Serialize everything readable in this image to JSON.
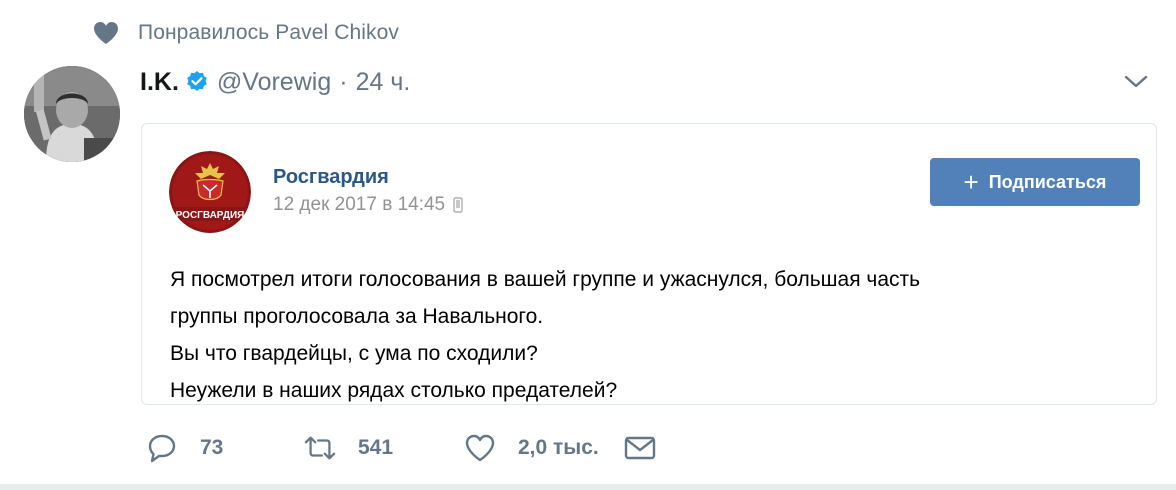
{
  "social_context": {
    "text": "Понравилось Pavel Chikov",
    "icon": "heart-icon"
  },
  "tweet": {
    "author_name": "I.K.",
    "handle": "@Vorewig",
    "separator": "·",
    "time": "24 ч.",
    "verified": true
  },
  "vk_post": {
    "group_name": "Росгвардия",
    "date": "12 дек 2017 в 14:45",
    "avatar_label": "РОСГВАРДИЯ",
    "subscribe_label": "Подписаться",
    "text_lines": [
      "Я посмотрел итоги голосования в вашей группе и ужаснулся, большая часть",
      "группы проголосовала за Навального.",
      "Вы что гвардейцы, с ума по сходили?",
      "Неужели в наших рядах столько предателей?"
    ]
  },
  "actions": {
    "replies": "73",
    "retweets": "541",
    "likes": "2,0 тыс."
  },
  "colors": {
    "vk_blue": "#5181b8",
    "vk_link": "#2a5885",
    "twitter_gray": "#657786",
    "verified_blue": "#1da1f2",
    "emblem_red": "#8b1414"
  }
}
